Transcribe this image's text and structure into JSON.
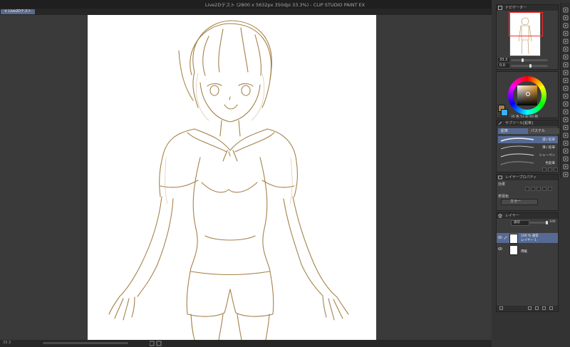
{
  "window": {
    "title": "Live2Dテスト (2800 x 5632px 350dpi 33.3%)  - CLIP STUDIO PAINT EX"
  },
  "document_tab": {
    "label": "× Live2Dテスト"
  },
  "navigator": {
    "title": "ナビゲーター",
    "zoom": "33.3",
    "rotation": "0.0"
  },
  "color": {
    "main_color": "#a88050",
    "sub_color": "#3ab0ff",
    "readout": {
      "h": "35",
      "s": "53",
      "v": "65"
    },
    "h_label": "色",
    "s_label": "彩",
    "v_label": "明"
  },
  "subtool": {
    "title": "サブツール[鉛筆]",
    "tabs": [
      {
        "label": "鉛筆"
      },
      {
        "label": "パステル"
      }
    ],
    "brushes": [
      {
        "label": "濃い鉛筆"
      },
      {
        "label": "薄い鉛筆"
      },
      {
        "label": "シャーペン"
      },
      {
        "label": "色鉛筆"
      }
    ]
  },
  "layer_property": {
    "title": "レイヤープロパティ",
    "effect_label": "効果",
    "expression_label": "表現色",
    "expression_value": "カラー"
  },
  "layers": {
    "title": "レイヤー",
    "blend_mode": "通常",
    "opacity": "100",
    "items": [
      {
        "line1": "100 % 通常",
        "line2": "レイヤー 1"
      },
      {
        "line1": "",
        "line2": "用紙"
      }
    ]
  },
  "status": {
    "zoom": "33.3"
  },
  "tool_icons": [
    "zoom-icon",
    "hand-icon",
    "rotate-icon",
    "move-icon",
    "select-rect-icon",
    "lasso-icon",
    "eyedropper-icon",
    "pen-icon",
    "pencil-icon",
    "brush-icon",
    "airbrush-icon",
    "decoration-icon",
    "eraser-icon",
    "blend-icon",
    "fill-icon",
    "gradient-icon",
    "figure-icon",
    "frame-icon",
    "text-icon",
    "balloon-icon",
    "ruler-icon",
    "correct-line-icon"
  ]
}
